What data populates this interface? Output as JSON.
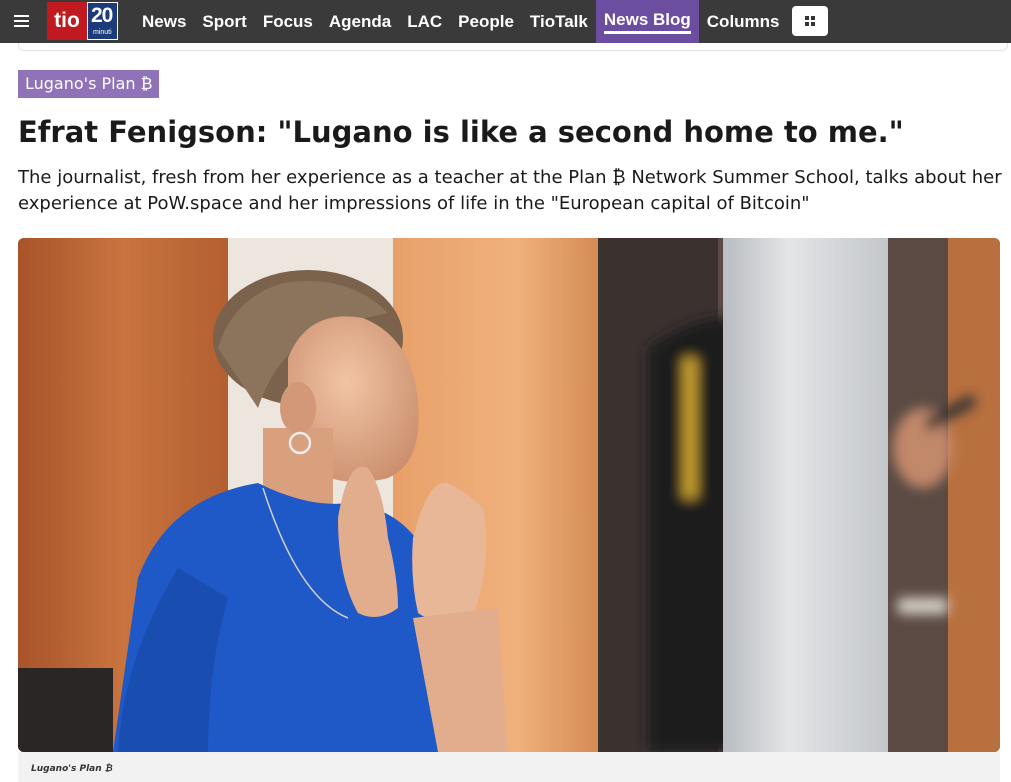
{
  "header": {
    "logo_left": "tio",
    "logo_right_number": "20",
    "logo_right_sub": "minuti",
    "nav": [
      {
        "label": "News"
      },
      {
        "label": "Sport"
      },
      {
        "label": "Focus"
      },
      {
        "label": "Agenda"
      },
      {
        "label": "LAC"
      },
      {
        "label": "People"
      },
      {
        "label": "TioTalk"
      },
      {
        "label": "News Blog",
        "active": true
      },
      {
        "label": "Columns"
      }
    ]
  },
  "article": {
    "category": "Lugano's Plan ₿",
    "title": "Efrat Fenigson: \"Lugano is like a second home to me.\"",
    "lead": "The journalist, fresh from her experience as a teacher at the Plan ₿ Network Summer School, talks about her experience at PoW.space and her impressions of life in the \"European capital of Bitcoin\"",
    "image_caption": "Lugano's Plan ₿"
  },
  "colors": {
    "topbar": "#3a3a3a",
    "accent_purple": "#6b4ea0",
    "category_bg": "#8f72b8",
    "logo_red": "#c0191f",
    "logo_blue": "#1b3b7a"
  },
  "icons": {
    "menu": "hamburger-icon",
    "apps": "apps-grid-icon"
  }
}
